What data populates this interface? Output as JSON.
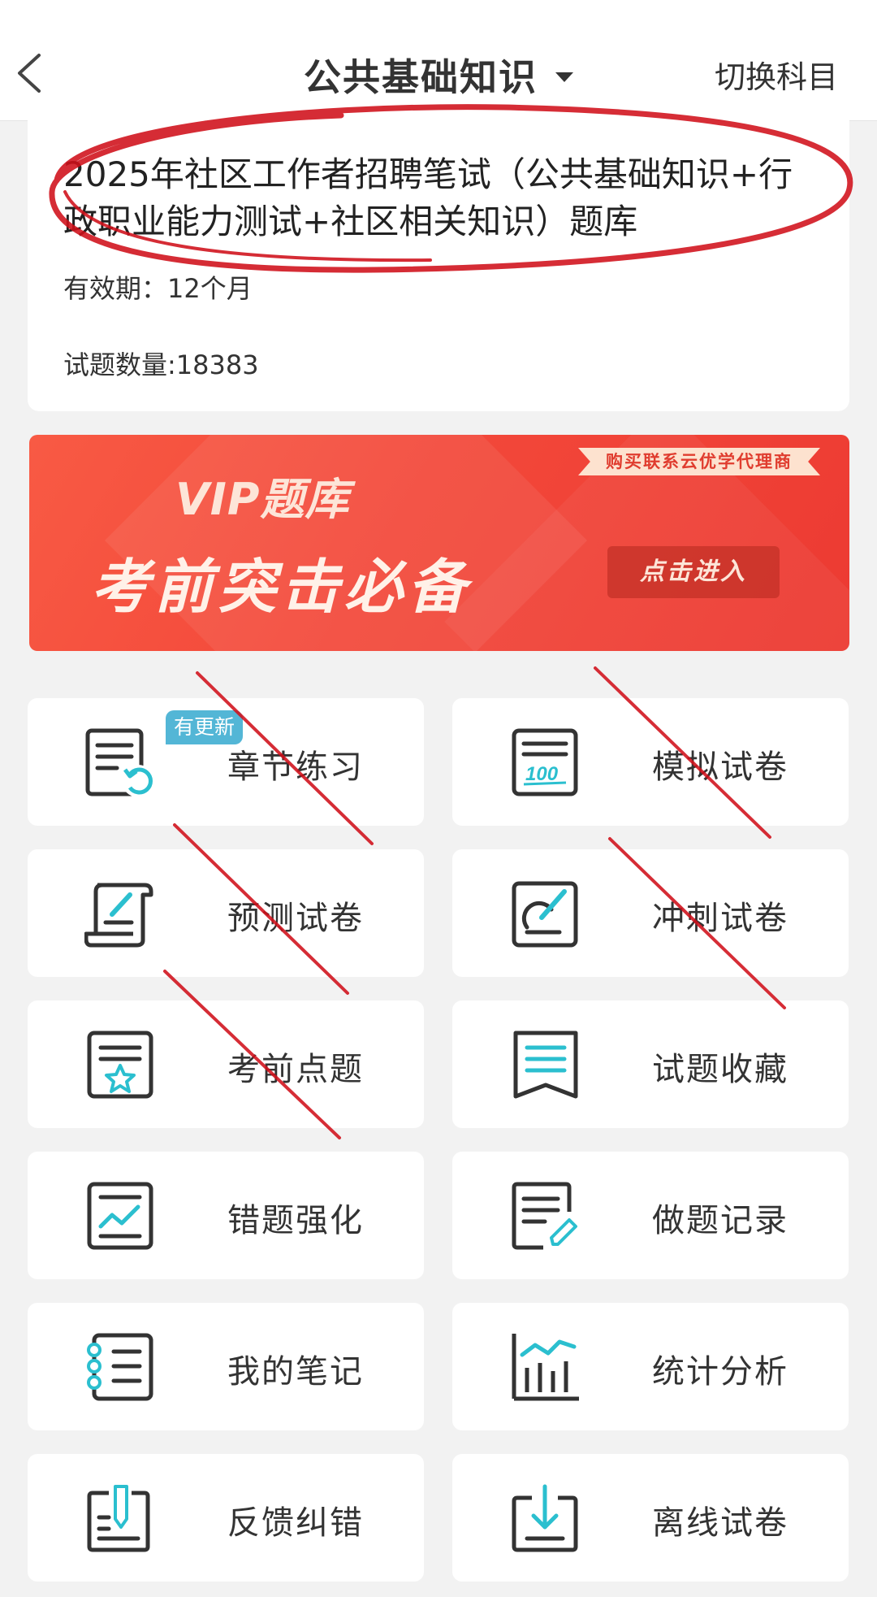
{
  "header": {
    "title": "公共基础知识",
    "switch_label": "切换科目"
  },
  "bank": {
    "title": "2025年社区工作者招聘笔试（公共基础知识+行政职业能力测试+社区相关知识）题库",
    "validity": "有效期：12个月",
    "question_count": "试题数量:18383"
  },
  "banner": {
    "ribbon": "购买联系云优学代理商",
    "vip_title": "VIP题库",
    "slogan": "考前突击必备",
    "button": "点击进入"
  },
  "badge": "有更新",
  "menu": [
    {
      "label": "章节练习",
      "icon": "chapter-practice-icon"
    },
    {
      "label": "模拟试卷",
      "icon": "mock-exam-icon"
    },
    {
      "label": "预测试卷",
      "icon": "forecast-exam-icon"
    },
    {
      "label": "冲刺试卷",
      "icon": "sprint-exam-icon"
    },
    {
      "label": "考前点题",
      "icon": "key-points-icon"
    },
    {
      "label": "试题收藏",
      "icon": "favorites-icon"
    },
    {
      "label": "错题强化",
      "icon": "wrong-questions-icon"
    },
    {
      "label": "做题记录",
      "icon": "practice-record-icon"
    },
    {
      "label": "我的笔记",
      "icon": "notes-icon"
    },
    {
      "label": "统计分析",
      "icon": "statistics-icon"
    },
    {
      "label": "反馈纠错",
      "icon": "feedback-icon"
    },
    {
      "label": "离线试卷",
      "icon": "offline-exam-icon"
    }
  ],
  "colors": {
    "accent_teal": "#2bbfcf",
    "banner_red": "#f3483a",
    "annotation_red": "#d0101a"
  }
}
